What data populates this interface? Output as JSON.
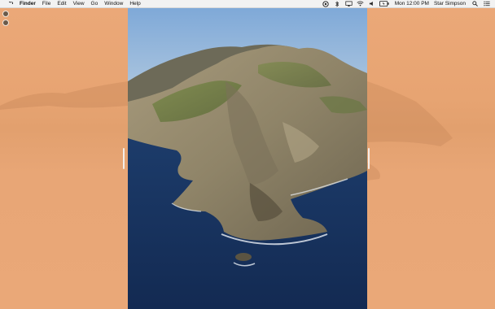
{
  "menubar": {
    "app_name": "Finder",
    "items": [
      "File",
      "Edit",
      "View",
      "Go",
      "Window",
      "Help"
    ],
    "status": {
      "clock": "Mon 12:00 PM",
      "user": "Star Simpson"
    },
    "status_icons": [
      "siri-icon",
      "bluetooth-icon",
      "screen-mirroring-icon",
      "wifi-icon",
      "volume-icon",
      "battery-icon",
      "spotlight-icon",
      "control-center-icon"
    ]
  },
  "desktop": {
    "icons": [
      "drive-icon",
      "disk-icon"
    ]
  },
  "wallpaper": {
    "name": "Catalina island",
    "colors": {
      "side_panels": "#e8a874",
      "sky": "#8fb7dc",
      "ocean": "#17315c"
    }
  }
}
